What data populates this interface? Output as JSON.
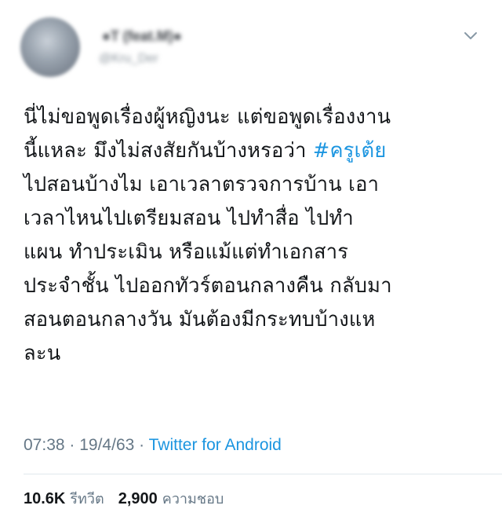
{
  "author": {
    "name": "●T (feat.M)●",
    "handle": "@Kru_Der"
  },
  "tweet": {
    "lines": [
      "นี่ไม่ขอพูดเรื่องผู้หญิงนะ แต่ขอพูดเรื่องงาน",
      "นี้แหละ มึงไม่สงสัยกันบ้างหรอว่า ",
      "ไปสอนบ้างไม เอาเวลาตรวจการบ้าน เอา",
      "เวลาไหนไปเตรียมสอน ไปทำสื่อ ไปทำ",
      "แผน ทำประเมิน หรือแม้แต่ทำเอกสาร",
      "ประจำชั้น ไปออกทัวร์ตอนกลางคืน กลับมา",
      "สอนตอนกลางวัน มันต้องมีกระทบบ้างแห",
      "ละน"
    ],
    "hashtag": "#ครูเต้ย"
  },
  "meta": {
    "time": "07:38",
    "separator": " · ",
    "date": "19/4/63",
    "source": "Twitter for Android"
  },
  "stats": {
    "retweets": "10.6K",
    "retweets_label": "รีทวีต",
    "likes": "2,900",
    "likes_label": "ความชอบ"
  },
  "icons": {
    "menu": "chevron-down-icon"
  },
  "colors": {
    "link": "#1b95e0",
    "secondary_text": "#657786",
    "primary_text": "#14171a"
  }
}
